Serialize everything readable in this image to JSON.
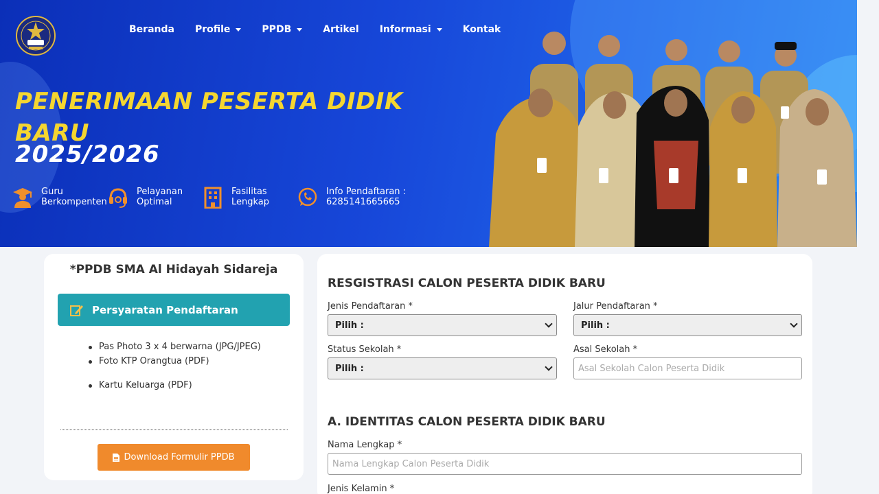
{
  "nav": {
    "items": [
      {
        "label": "Beranda",
        "dropdown": false
      },
      {
        "label": "Profile",
        "dropdown": true
      },
      {
        "label": "PPDB",
        "dropdown": true
      },
      {
        "label": "Artikel",
        "dropdown": false
      },
      {
        "label": "Informasi",
        "dropdown": true
      },
      {
        "label": "Kontak",
        "dropdown": false
      }
    ]
  },
  "hero": {
    "title": "PENERIMAAN PESERTA DIDIK BARU",
    "year": "2025/2026",
    "features": [
      {
        "line1": "Guru",
        "line2": "Berkompenten",
        "icon": "teacher-icon"
      },
      {
        "line1": "Pelayanan",
        "line2": "Optimal",
        "icon": "headset-icon"
      },
      {
        "line1": "Fasilitas",
        "line2": "Lengkap",
        "icon": "building-icon"
      },
      {
        "line1": "Info Pendaftaran :",
        "line2": "6285141665665",
        "icon": "whatsapp-icon"
      }
    ]
  },
  "left_card": {
    "title": "*PPDB SMA Al Hidayah Sidareja",
    "requirements_button": "Persyaratan Pendaftaran",
    "requirements": [
      "Pas Photo 3 x 4 berwarna (JPG/JPEG)",
      "Foto KTP Orangtua (PDF)",
      "Kartu Keluarga (PDF)"
    ],
    "download_button": "Download Formulir PPDB"
  },
  "form": {
    "section1_title": "RESGISTRASI CALON PESERTA DIDIK BARU",
    "jenis_label": "Jenis Pendaftaran *",
    "jenis_value": "Pilih :",
    "jalur_label": "Jalur Pendaftaran *",
    "jalur_value": "Pilih :",
    "status_label": "Status Sekolah *",
    "status_value": "Pilih :",
    "asal_label": "Asal Sekolah *",
    "asal_placeholder": "Asal Sekolah Calon Peserta Didik",
    "section2_title": "A. IDENTITAS CALON PESERTA DIDIK BARU",
    "nama_label": "Nama Lengkap *",
    "nama_placeholder": "Nama Lengkap Calon Peserta Didik",
    "kelamin_label": "Jenis Kelamin *"
  },
  "colors": {
    "hero_blue": "#1747d9",
    "title_yellow": "#f5d630",
    "icon_orange": "#f0902c",
    "teal": "#22a2b0",
    "orange_button": "#f08a2c"
  }
}
